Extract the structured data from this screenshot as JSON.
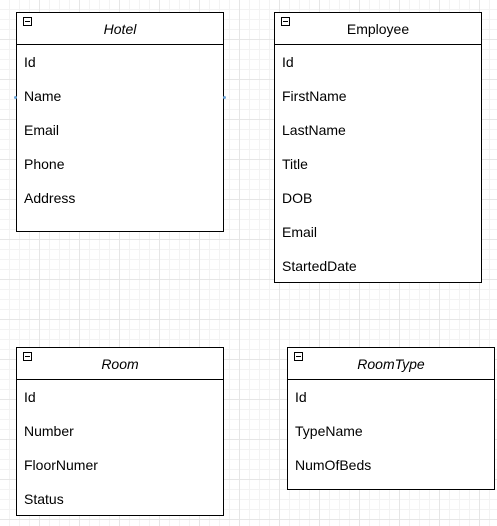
{
  "entities": {
    "hotel": {
      "title": "Hotel",
      "fields": [
        "Id",
        "Name",
        "Email",
        "Phone",
        "Address"
      ]
    },
    "employee": {
      "title": "Employee",
      "fields": [
        "Id",
        "FirstName",
        "LastName",
        "Title",
        "DOB",
        "Email",
        "StartedDate"
      ]
    },
    "room": {
      "title": "Room",
      "fields": [
        "Id",
        "Number",
        "FloorNumer",
        "Status"
      ]
    },
    "roomtype": {
      "title": "RoomType",
      "fields": [
        "Id",
        "TypeName",
        "NumOfBeds"
      ]
    }
  },
  "icons": {
    "collapse": "minus-square-icon",
    "connection_point": "connection-point-icon"
  },
  "colors": {
    "border": "#000000",
    "grid": "#e6e6e6",
    "connection_point": "#6fa8dc"
  }
}
